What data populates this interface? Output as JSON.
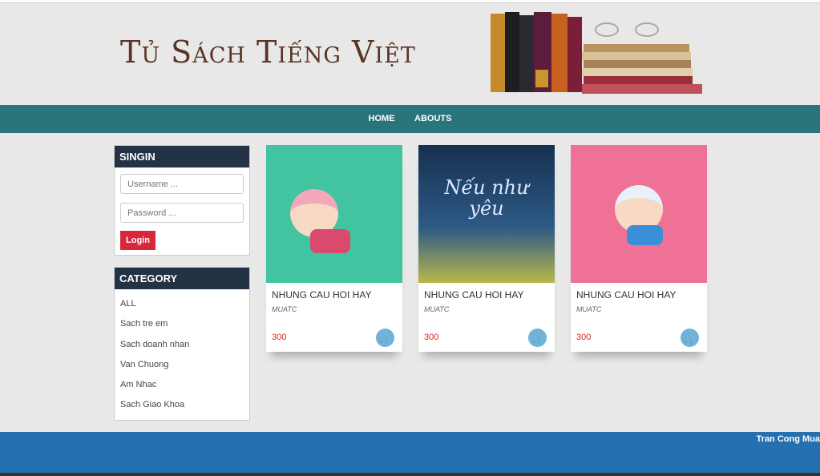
{
  "header": {
    "title": "Tủ Sách Tiếng Việt"
  },
  "nav": {
    "items": [
      "HOME",
      "ABOUTS"
    ]
  },
  "signin": {
    "title": "SINGIN",
    "username_placeholder": "Username ...",
    "password_placeholder": "Password ...",
    "login_label": "Login"
  },
  "category": {
    "title": "CATEGORY",
    "items": [
      "ALL",
      "Sach tre em",
      "Sach doanh nhan",
      "Van Chuong",
      "Am Nhac",
      "Sach Giao Khoa"
    ]
  },
  "products": [
    {
      "title": "NHUNG CAU HOI HAY",
      "author": "MUATC",
      "price": "300",
      "color": "#43c4a0"
    },
    {
      "title": "NHUNG CAU HOI HAY",
      "author": "MUATC",
      "price": "300",
      "color": "#1c3a5e",
      "cover_text": "Nếu như yêu"
    },
    {
      "title": "NHUNG CAU HOI HAY",
      "author": "MUATC",
      "price": "300",
      "color": "#ef7196"
    }
  ],
  "footer": {
    "text": "Tran Cong Mua"
  }
}
